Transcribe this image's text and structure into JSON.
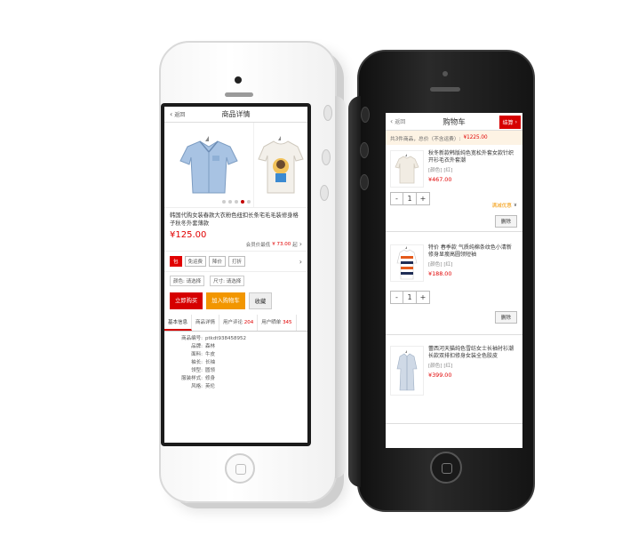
{
  "product_page": {
    "back_label": "返回",
    "title": "商品详情",
    "name": "韩国代购女装春款大衣粉色纽扣长条宅毛毛装修身格子秋冬外套薄款",
    "price": "¥125.00",
    "member_label": "会员价最低",
    "member_price": "¥ 73.00",
    "member_suffix": "起",
    "tags": [
      "包",
      "免运费",
      "降价",
      "打折"
    ],
    "options": [
      "颜色: 请选择",
      "尺寸: 请选择"
    ],
    "buy_now": "立即购买",
    "add_to_cart": "加入购物车",
    "favorite": "收藏",
    "tabs": [
      {
        "label": "基本信息",
        "count": ""
      },
      {
        "label": "商品详情",
        "count": ""
      },
      {
        "label": "用户评论",
        "count": "204"
      },
      {
        "label": "用户晒单",
        "count": "345"
      }
    ],
    "info_rows": [
      {
        "k": "商品编号:",
        "v": "ptkdt938458952"
      },
      {
        "k": "品牌:",
        "v": "森林"
      },
      {
        "k": "面料:",
        "v": "牛皮"
      },
      {
        "k": "袖长:",
        "v": "长袖"
      },
      {
        "k": "领型:",
        "v": "圆领"
      },
      {
        "k": "服装样式:",
        "v": "修身"
      },
      {
        "k": "风格:",
        "v": "英伦"
      }
    ]
  },
  "cart_page": {
    "back_label": "返回",
    "title": "购物车",
    "checkout": "结算",
    "total_prefix": "共3件商品，总价（不含运费）:",
    "total_value": "¥1225.00",
    "promo_label": "满减优惠",
    "delete_label": "删除",
    "items": [
      {
        "name": "秋冬新款韩版纯色宽松外套女款针织开衫毛衣外套潮",
        "meta": "[颜色]  [红]",
        "price": "¥467.00",
        "qty": "1"
      },
      {
        "name": "特价 春季款 气质纯棉条纹色小清新 修身显瘦高圆领短袖",
        "meta": "[颜色]  [红]",
        "price": "¥188.00",
        "qty": "1"
      },
      {
        "name": "蕾西河天猫纯色雪纺女士长袖衬衫潮长款双排扣修身女装全色胶皮",
        "meta": "[颜色]  [红]",
        "price": "¥399.00",
        "qty": ""
      }
    ]
  }
}
